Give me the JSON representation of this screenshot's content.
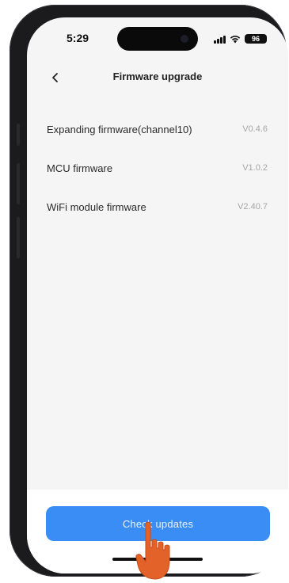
{
  "status_bar": {
    "time": "5:29",
    "battery": "96",
    "icons": [
      "signal-icon",
      "wifi-icon",
      "battery-icon"
    ]
  },
  "header": {
    "back_icon": "chevron-left-icon",
    "title": "Firmware upgrade"
  },
  "firmware": [
    {
      "name": "Expanding firmware(channel10)",
      "version": "V0.4.6"
    },
    {
      "name": "MCU firmware",
      "version": "V1.0.2"
    },
    {
      "name": "WiFi module firmware",
      "version": "V2.40.7"
    }
  ],
  "actions": {
    "check_updates_label": "Check  updates"
  },
  "colors": {
    "accent": "#3b8df6",
    "background": "#f5f5f6",
    "version_text": "#a6a6a6",
    "tap_hand": "#e2622a"
  }
}
